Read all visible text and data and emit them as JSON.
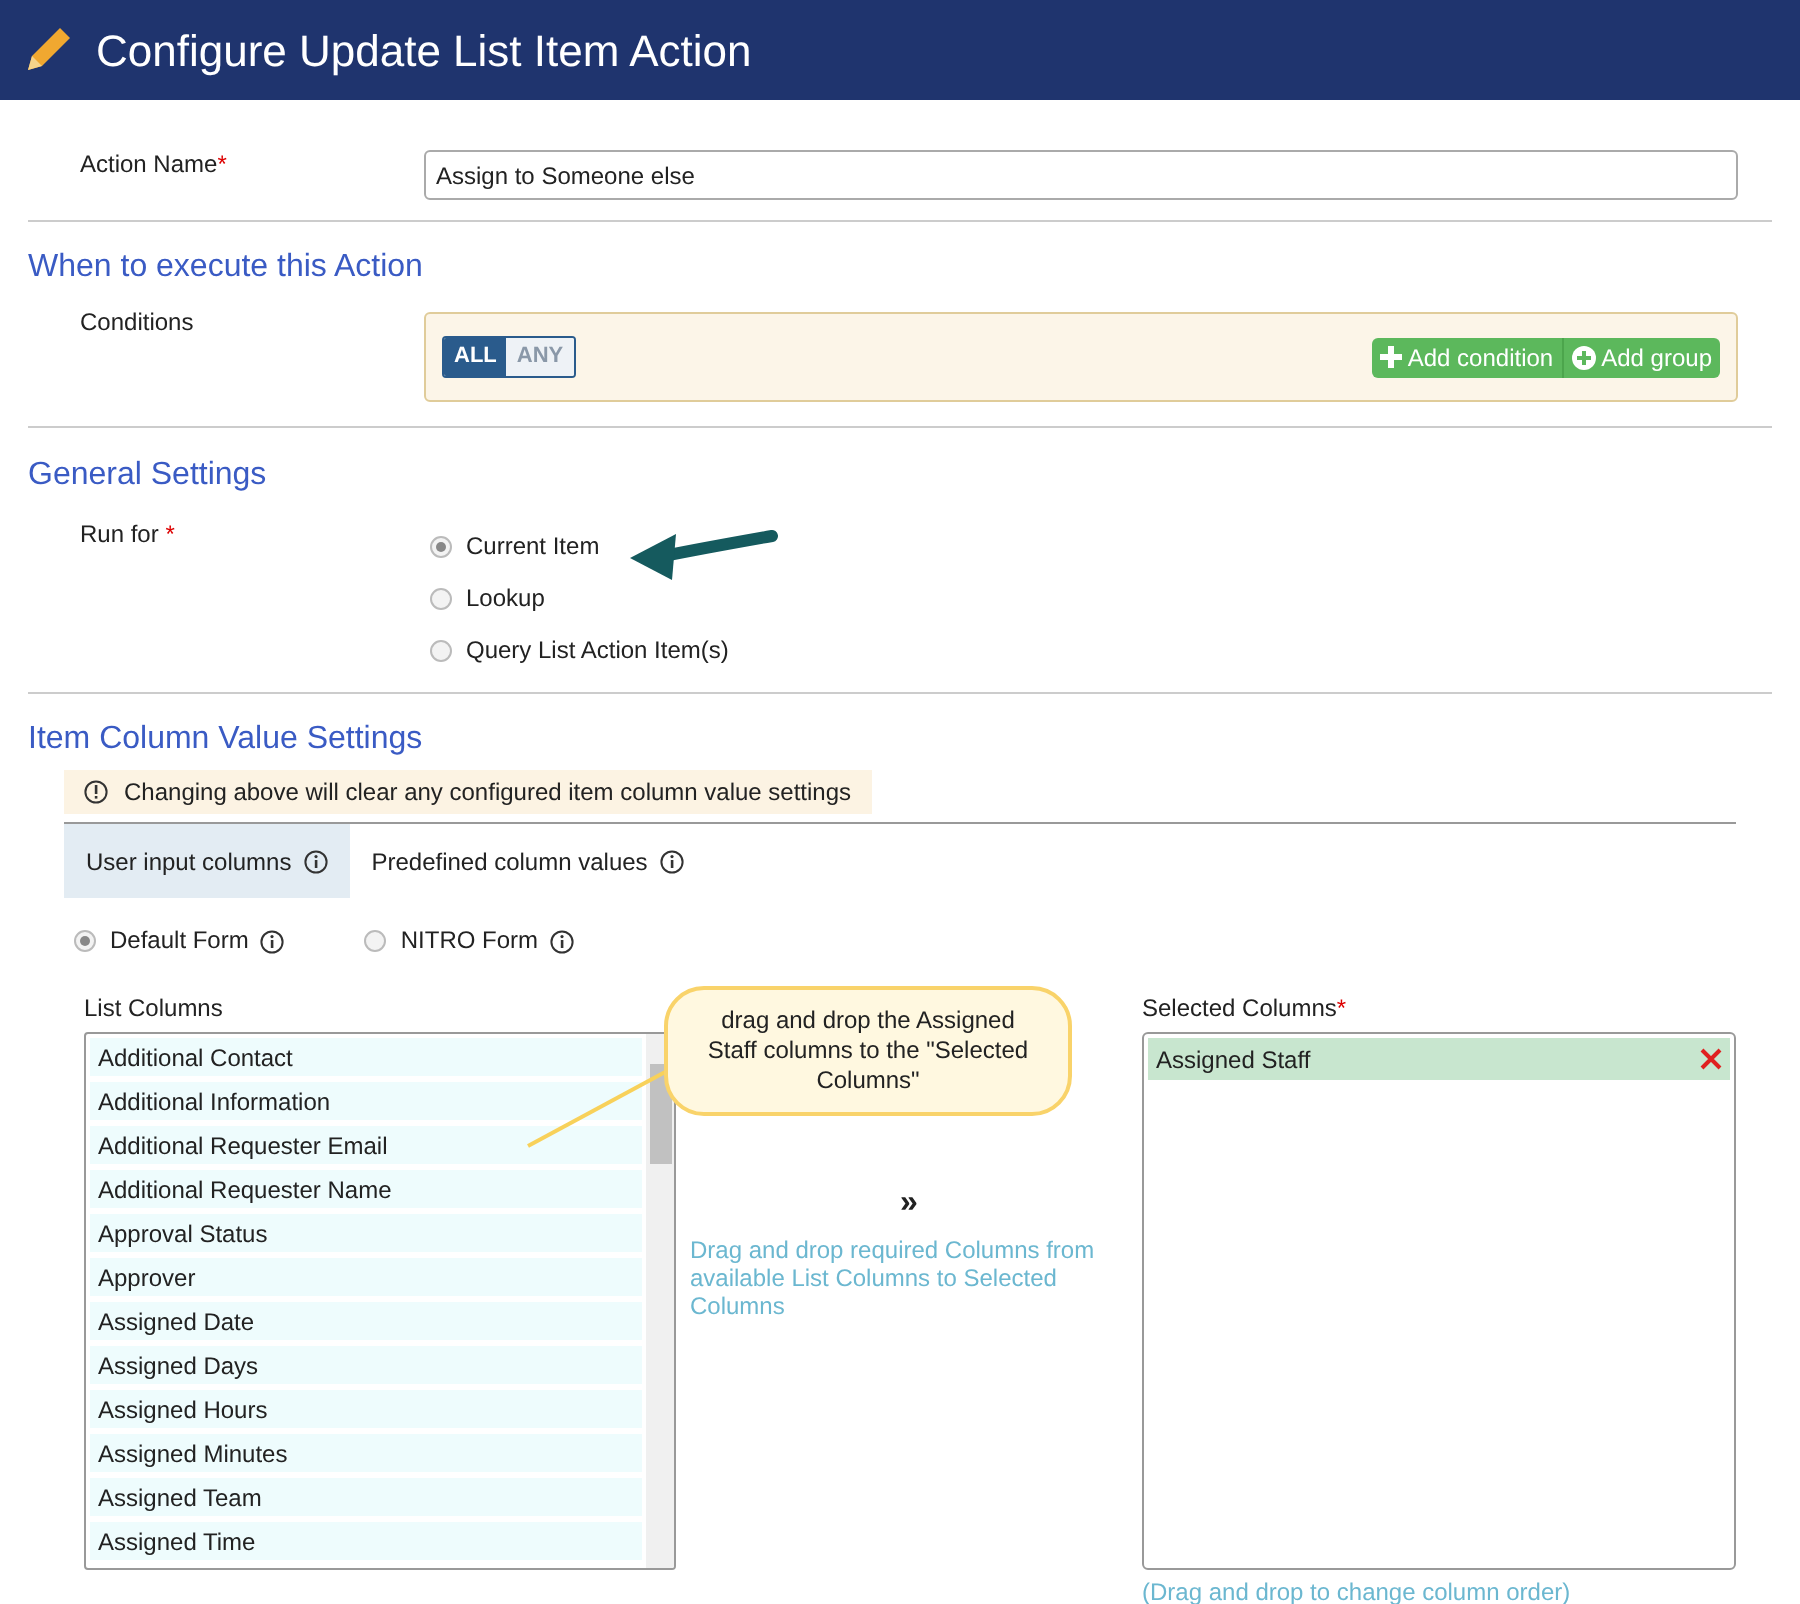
{
  "header": {
    "title": "Configure Update List Item Action"
  },
  "action_name": {
    "label": "Action Name",
    "required_mark": "*",
    "value": "Assign to Someone else"
  },
  "when_section": {
    "title": "When to execute this Action",
    "conditions_label": "Conditions",
    "match_toggle": [
      {
        "label": "ALL",
        "selected": true
      },
      {
        "label": "ANY",
        "selected": false
      }
    ],
    "buttons": [
      {
        "label": "Add condition",
        "kind": "plus"
      },
      {
        "label": "Add group",
        "kind": "circle-plus"
      }
    ]
  },
  "general_section": {
    "title": "General Settings",
    "run_for_label": "Run for",
    "required_mark": "*",
    "options": [
      {
        "label": "Current Item",
        "selected": true
      },
      {
        "label": "Lookup",
        "selected": false
      },
      {
        "label": "Query List Action Item(s)",
        "selected": false
      }
    ]
  },
  "item_section": {
    "title": "Item Column Value Settings",
    "warning": "Changing above will clear any configured item column value settings",
    "tabs": [
      {
        "label": "User input columns",
        "selected": true
      },
      {
        "label": "Predefined column values",
        "selected": false
      }
    ],
    "form_options": [
      {
        "label": "Default Form",
        "selected": true
      },
      {
        "label": "NITRO Form",
        "selected": false
      }
    ],
    "list_columns_label": "List Columns",
    "list_columns": [
      "Additional Contact",
      "Additional Information",
      "Additional Requester Email",
      "Additional Requester Name",
      "Approval Status",
      "Approver",
      "Assigned Date",
      "Assigned Days",
      "Assigned Hours",
      "Assigned Minutes",
      "Assigned Team",
      "Assigned Time"
    ],
    "move_glyph": "»",
    "hint": "Drag and drop required Columns from available List Columns to Selected Columns",
    "selected_label": "Selected Columns",
    "selected_required_mark": "*",
    "selected_columns": [
      "Assigned Staff"
    ],
    "order_hint": "(Drag and drop to change column order)"
  },
  "callout": {
    "text": "drag and drop the Assigned Staff columns to the \"Selected Columns\""
  }
}
